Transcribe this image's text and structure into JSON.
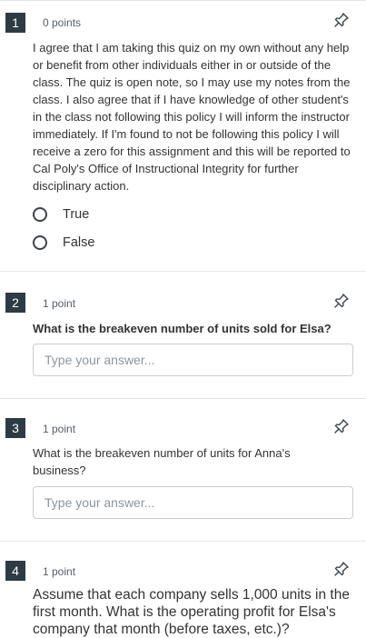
{
  "questions": [
    {
      "number": "1",
      "points": "0 points",
      "text": "I agree that I am taking this quiz on my own without any help or benefit from other individuals either in or outside of the class.  The quiz is open note, so I may use my notes from the class.  I also agree that if I have knowledge of other student's in the class not following this policy I will inform the instructor immediately.  If I'm found to not be following this policy I will receive a zero for this assignment and this will be reported to Cal Poly's Office of Instructional Integrity for further disciplinary action.",
      "options": [
        "True",
        "False"
      ]
    },
    {
      "number": "2",
      "points": "1 point",
      "text": "What is the breakeven number of units sold for Elsa?",
      "placeholder": "Type your answer..."
    },
    {
      "number": "3",
      "points": "1 point",
      "text": "What is the breakeven number of units for Anna's business?",
      "placeholder": "Type your answer..."
    },
    {
      "number": "4",
      "points": "1 point",
      "text": "Assume that each company sells 1,000 units in the first month.  What is the operating profit for Elsa's company that month (before taxes, etc.)?"
    }
  ]
}
